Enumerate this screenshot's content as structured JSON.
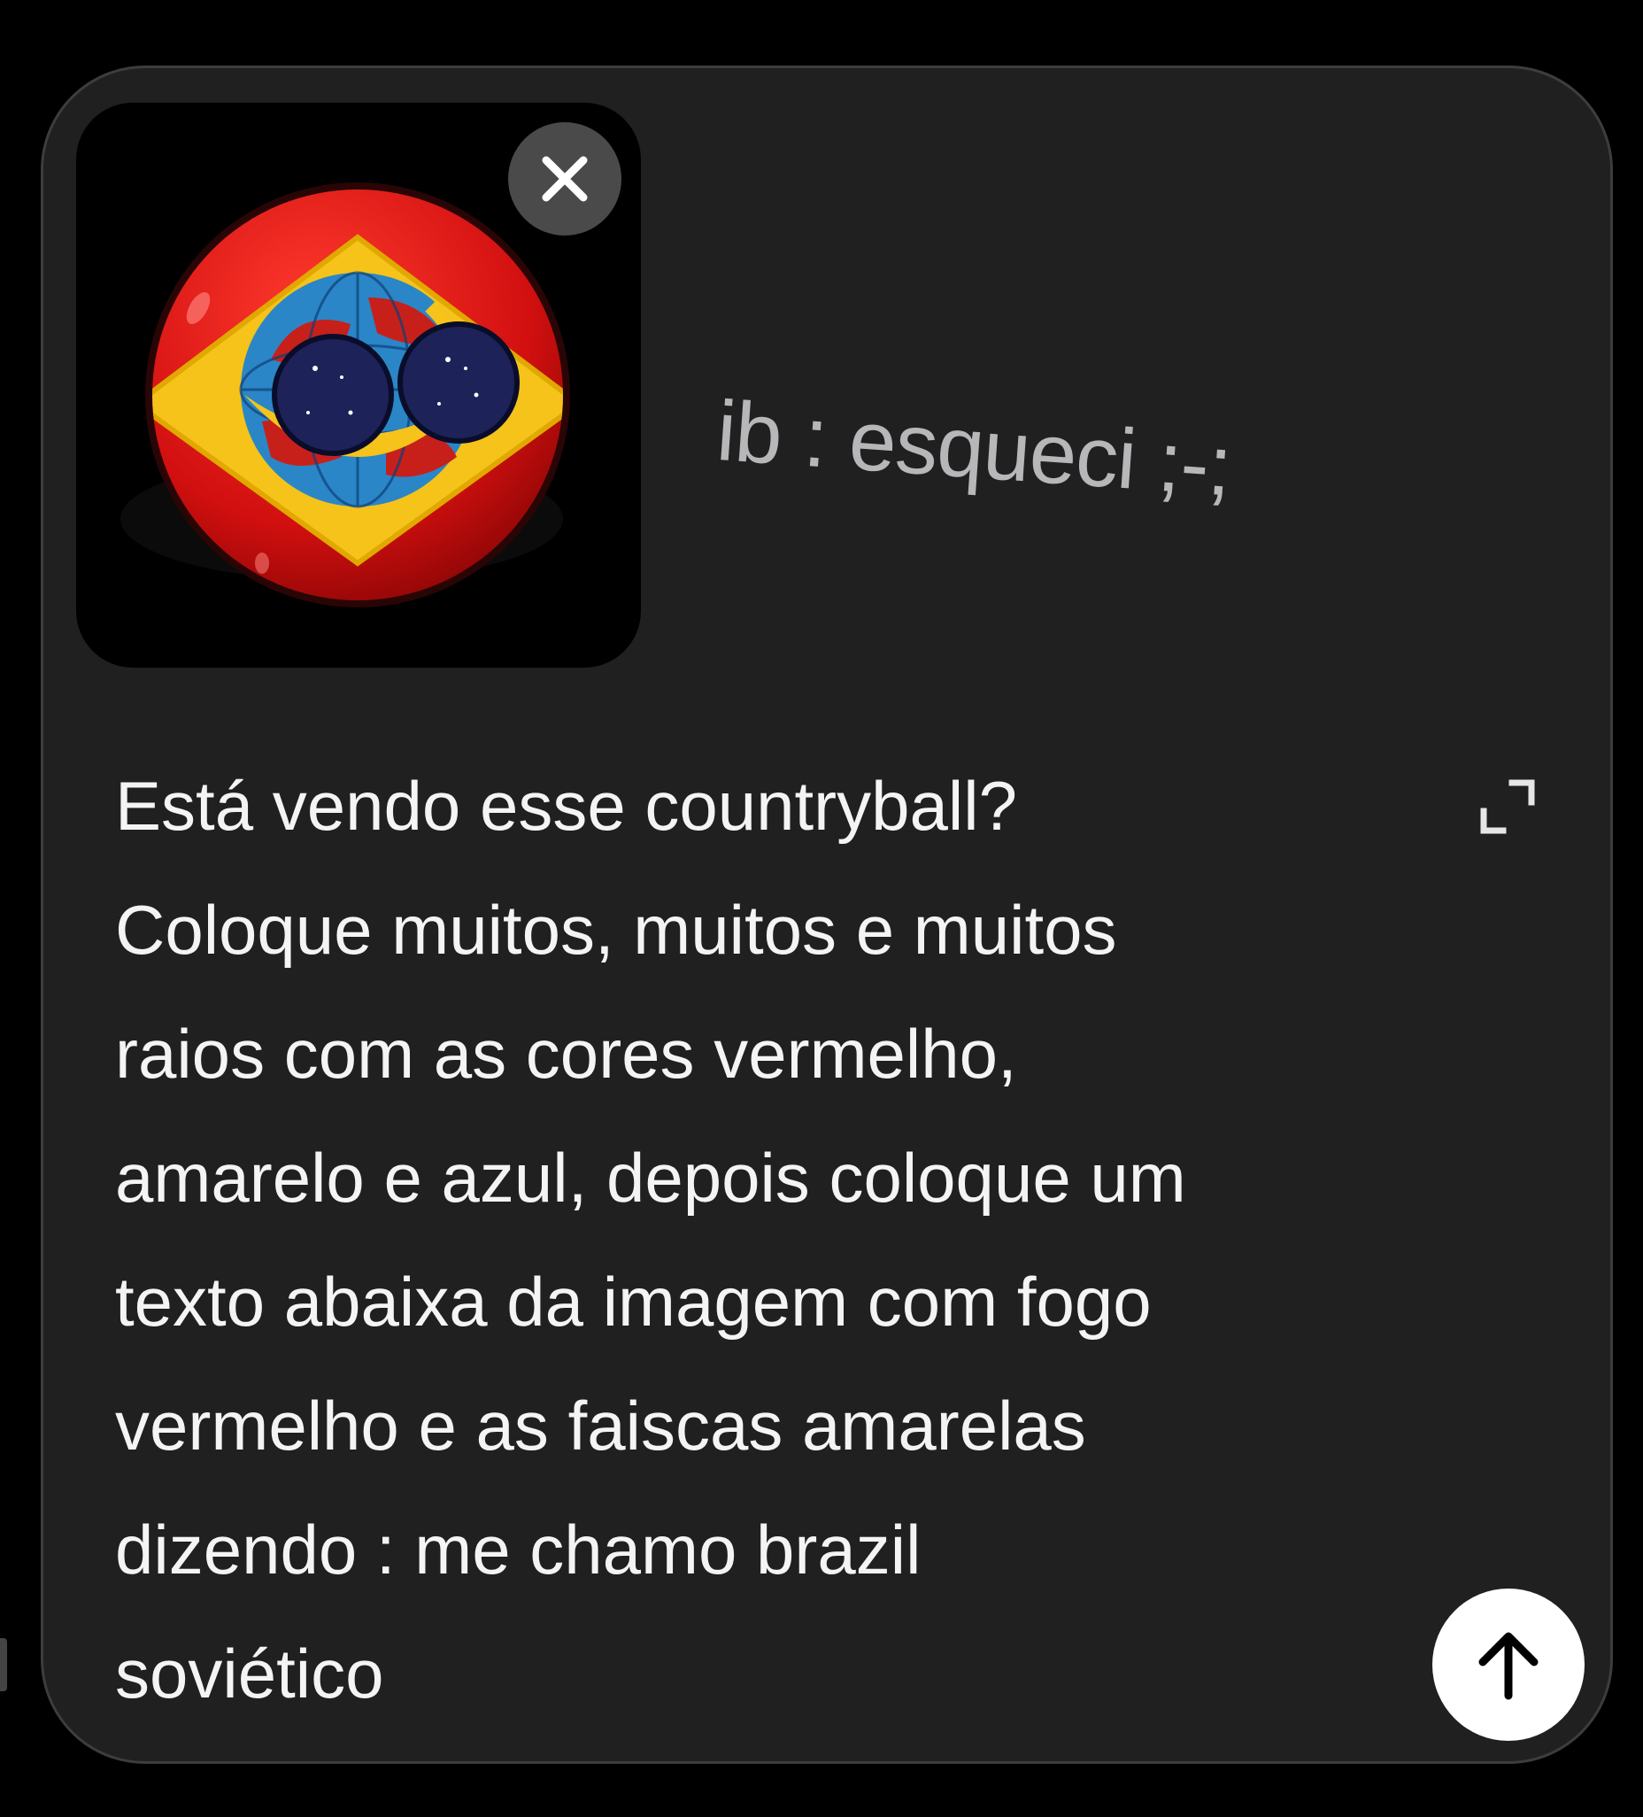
{
  "composer": {
    "attachment": {
      "icon": "countryball-image",
      "remove_icon": "close-icon",
      "colors": {
        "ball_red": "#d10f0f",
        "diamond_yellow": "#f6c31a",
        "globe_blue": "#2a86c7",
        "eyes_navy": "#1d2259"
      }
    },
    "caption": "ib : esqueci ;-;",
    "prompt_text": "Está vendo esse countryball?\nColoque muitos, muitos e muitos\nraios com as cores vermelho,\namarelo e azul, depois coloque um\ntexto abaixa da imagem com fogo\nvermelho e as faiscas amarelas\ndizendo : me chamo brazil\nsoviético",
    "expand_icon": "expand-icon",
    "send_icon": "arrow-up-icon",
    "colors": {
      "panel_bg": "#202021",
      "page_bg": "#000000",
      "text": "#f4f4f4",
      "caption": "#b7b7ba"
    }
  }
}
